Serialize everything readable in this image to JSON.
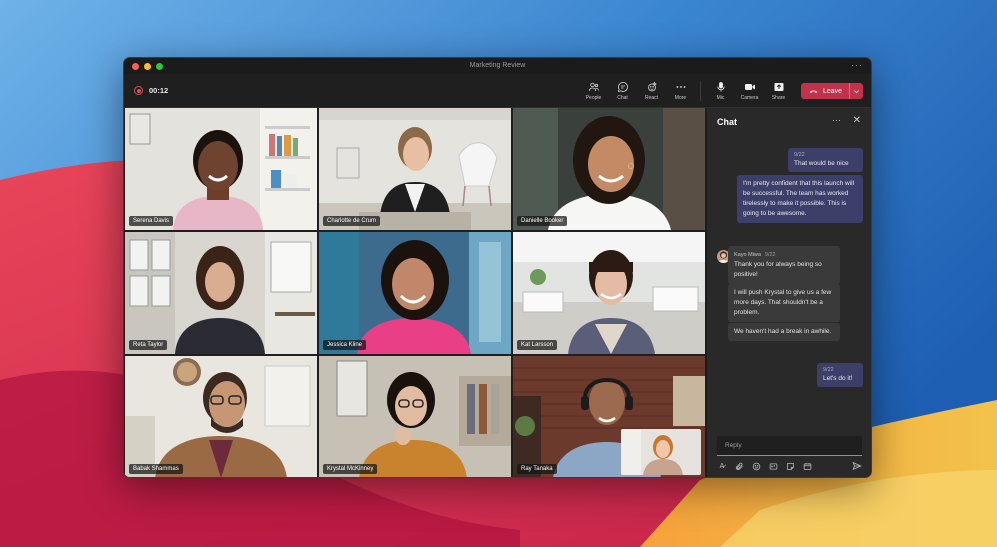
{
  "window": {
    "title": "Marketing Review"
  },
  "toolbar": {
    "timer": "00:12",
    "tools": [
      {
        "id": "people",
        "label": "People",
        "icon": "people-icon"
      },
      {
        "id": "chat",
        "label": "Chat",
        "icon": "chat-icon"
      },
      {
        "id": "react",
        "label": "React",
        "icon": "react-icon"
      },
      {
        "id": "more",
        "label": "More",
        "icon": "more-icon"
      },
      {
        "id": "mic",
        "label": "Mic",
        "icon": "mic-icon"
      },
      {
        "id": "camera",
        "label": "Camera",
        "icon": "camera-icon"
      },
      {
        "id": "share",
        "label": "Share",
        "icon": "share-icon"
      }
    ],
    "leave_label": "Leave"
  },
  "participants": [
    {
      "name": "Serena Davis"
    },
    {
      "name": "Charlotte de Crum"
    },
    {
      "name": "Danielle Booker"
    },
    {
      "name": "Reta Taylor"
    },
    {
      "name": "Jessica Kline"
    },
    {
      "name": "Kat Larsson"
    },
    {
      "name": "Babak Shammas"
    },
    {
      "name": "Krystal McKinney"
    },
    {
      "name": "Ray Tanaka"
    }
  ],
  "chat": {
    "title": "Chat",
    "messages": [
      {
        "time": "9/22",
        "text": "That would be nice"
      },
      {
        "text": "I'm pretty confident that this launch will be successful. The team has worked tirelessly to make it possible. This is going to be awesome."
      },
      {
        "sender": "Kayo Miwa",
        "time": "9/22",
        "text": "Thank you for always being so positive!"
      },
      {
        "text": "I will push Krystal to give us a few more days. That shouldn't be a problem."
      },
      {
        "text": "We haven't had a break in awhile."
      },
      {
        "time": "9/22",
        "text": "Let's do it!"
      }
    ],
    "reply_placeholder": "Reply"
  },
  "colors": {
    "accent": "#7f85f5",
    "leave": "#c4314b",
    "recording": "#e04a5a",
    "my_bubble": "#3d3f6b"
  }
}
